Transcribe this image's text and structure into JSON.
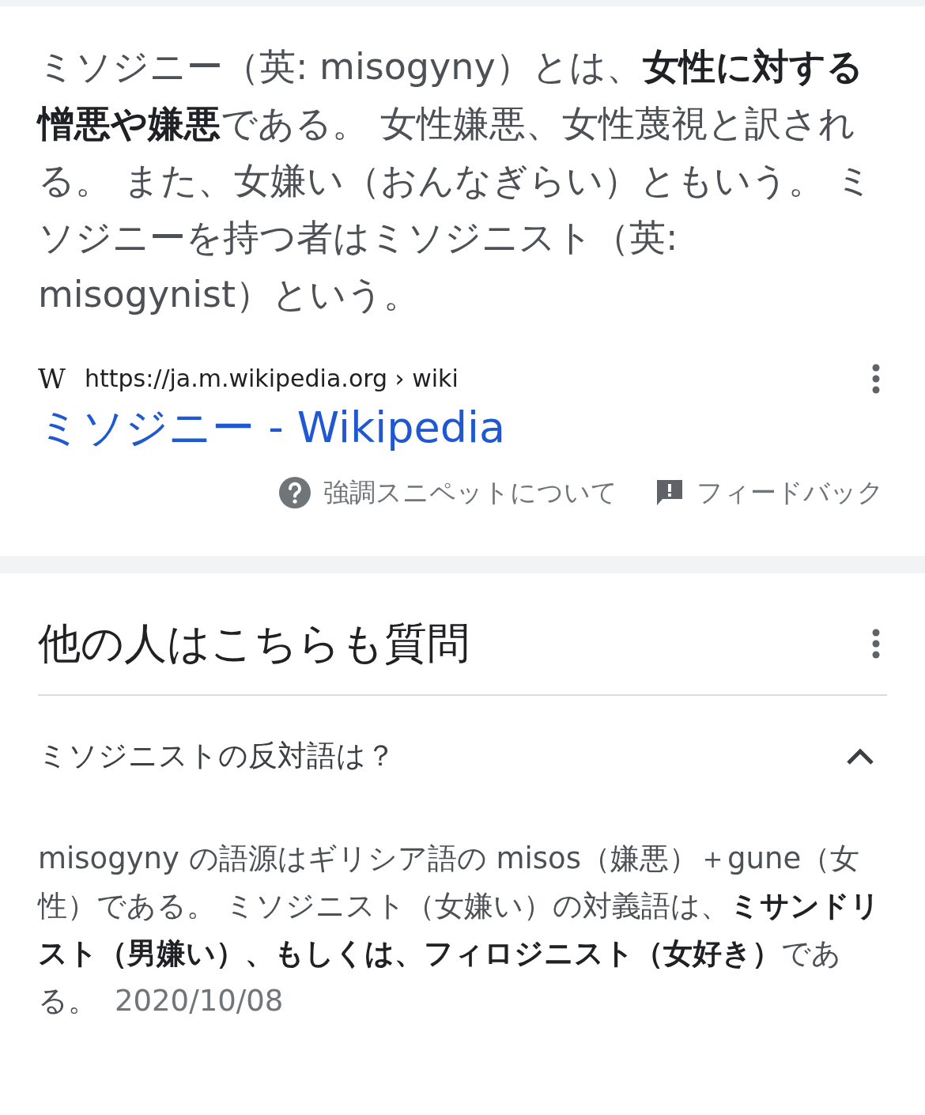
{
  "snippet": {
    "text": "ミソジニー（英: misogyny）とは、**女性に対する憎悪や嫌悪**である。 女性嫌悪、女性蔑視と訳される。 また、女嫌い（おんなぎらい）ともいう。 ミソジニーを持つ者はミソジニスト（英: misogynist）という。",
    "site_icon": "W",
    "url": "https://ja.m.wikipedia.org › wiki",
    "title": "ミソジニー - Wikipedia",
    "about": "強調スニペットについて",
    "feedback": "フィードバック"
  },
  "related": {
    "heading": "他の人はこちらも質問",
    "questions": [
      {
        "question": "ミソジニストの反対語は？",
        "expanded": true,
        "answer": "misogyny の語源はギリシア語の misos（嫌悪）＋gune（女性）である。 ミソジニスト（女嫌い）の対義語は、**ミサンドリスト（男嫌い）、もしくは、フィロジニスト（女好き）**である。",
        "date": "2020/10/08"
      }
    ]
  }
}
